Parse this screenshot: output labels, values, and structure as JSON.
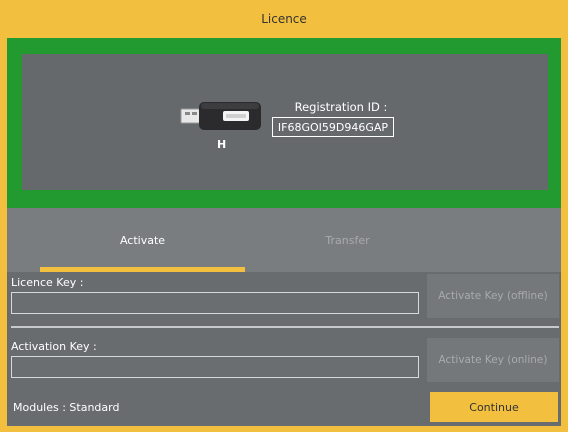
{
  "window": {
    "title": "Licence"
  },
  "device": {
    "icon": "usb-drive-icon",
    "drive_letter": "H",
    "registration_label": "Registration ID :",
    "registration_id": "IF68GOI59D946GAP"
  },
  "tabs": [
    {
      "label": "Activate",
      "active": true
    },
    {
      "label": "Transfer",
      "active": false
    }
  ],
  "form": {
    "licence_key_label": "Licence Key :",
    "licence_key_value": "",
    "activate_offline_label": "Activate Key (offline)",
    "activation_key_label": "Activation Key :",
    "activation_key_value": "",
    "activate_online_label": "Activate Key (online)"
  },
  "footer": {
    "modules_text": "Modules : Standard",
    "continue_label": "Continue"
  },
  "colors": {
    "accent": "#f2bf3f",
    "green": "#239a2f",
    "panel": "#66696c",
    "background": "#7a7d80"
  }
}
